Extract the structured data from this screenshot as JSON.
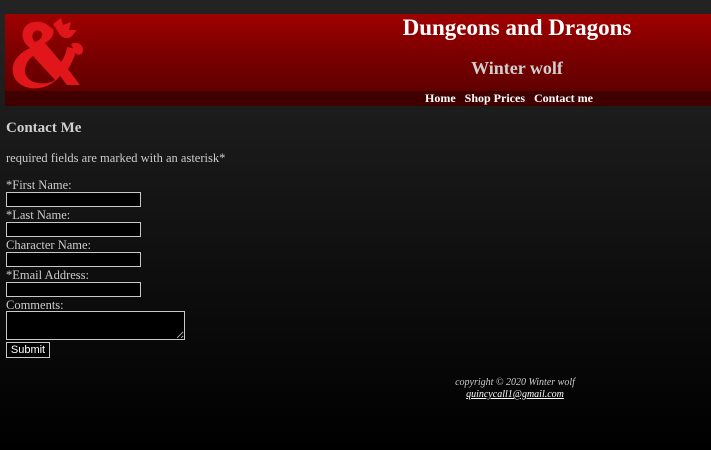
{
  "header": {
    "title": "Dungeons and Dragons",
    "subtitle": "Winter wolf",
    "logo_icon": "ampersand-dragon-logo",
    "accent_color": "#a00000"
  },
  "nav": {
    "items": [
      {
        "label": "Home"
      },
      {
        "label": "Shop Prices"
      },
      {
        "label": "Contact me"
      }
    ]
  },
  "main": {
    "heading": "Contact Me",
    "required_note": "required fields are marked with an asterisk*",
    "form": {
      "first_name_label": "*First Name:",
      "first_name_value": "",
      "last_name_label": "*Last Name:",
      "last_name_value": "",
      "character_name_label": "Character Name:",
      "character_name_value": "",
      "email_label": "*Email Address:",
      "email_value": "",
      "comments_label": "Comments:",
      "comments_value": "",
      "submit_label": "Submit"
    }
  },
  "footer": {
    "copyright": "copyright © 2020 Winter wolf",
    "email": "quincycall1@gmail.com"
  }
}
